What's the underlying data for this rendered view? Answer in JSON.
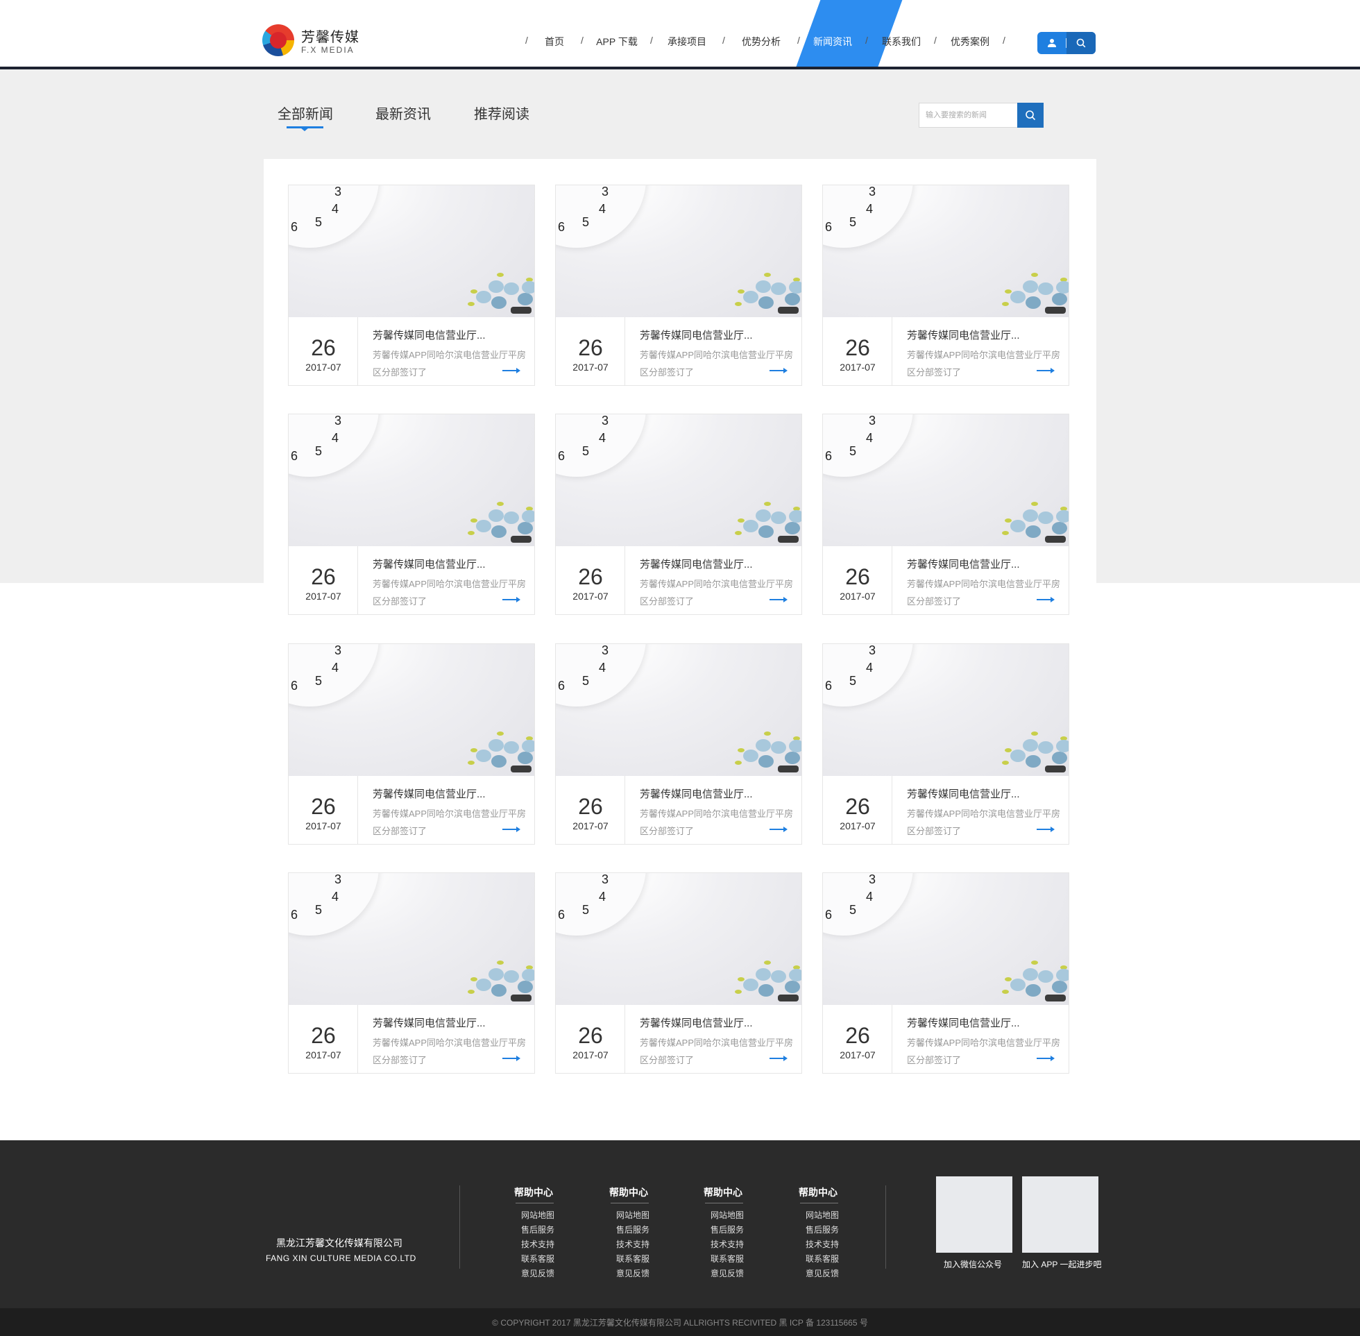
{
  "brand": {
    "name_cn": "芳馨传媒",
    "name_en": "F.X MEDIA"
  },
  "nav": {
    "items": [
      "首页",
      "APP 下载",
      "承接项目",
      "优势分析",
      "新闻资讯",
      "联系我们",
      "优秀案例"
    ],
    "active": "新闻资讯",
    "separator": "/"
  },
  "header_actions": {
    "user_icon": "user-icon",
    "search_icon": "search-icon"
  },
  "tabs": [
    "全部新闻",
    "最新资讯",
    "推荐阅读"
  ],
  "search": {
    "placeholder": "输入要搜索的新闻"
  },
  "news": {
    "items": [
      {
        "day": "26",
        "month": "2017-07",
        "title": "芳馨传媒同电信营业厅...",
        "desc": "芳馨传媒APP同哈尔滨电信营业厅平房区分部签订了"
      },
      {
        "day": "26",
        "month": "2017-07",
        "title": "芳馨传媒同电信营业厅...",
        "desc": "芳馨传媒APP同哈尔滨电信营业厅平房区分部签订了"
      },
      {
        "day": "26",
        "month": "2017-07",
        "title": "芳馨传媒同电信营业厅...",
        "desc": "芳馨传媒APP同哈尔滨电信营业厅平房区分部签订了"
      },
      {
        "day": "26",
        "month": "2017-07",
        "title": "芳馨传媒同电信营业厅...",
        "desc": "芳馨传媒APP同哈尔滨电信营业厅平房区分部签订了"
      },
      {
        "day": "26",
        "month": "2017-07",
        "title": "芳馨传媒同电信营业厅...",
        "desc": "芳馨传媒APP同哈尔滨电信营业厅平房区分部签订了"
      },
      {
        "day": "26",
        "month": "2017-07",
        "title": "芳馨传媒同电信营业厅...",
        "desc": "芳馨传媒APP同哈尔滨电信营业厅平房区分部签订了"
      },
      {
        "day": "26",
        "month": "2017-07",
        "title": "芳馨传媒同电信营业厅...",
        "desc": "芳馨传媒APP同哈尔滨电信营业厅平房区分部签订了"
      },
      {
        "day": "26",
        "month": "2017-07",
        "title": "芳馨传媒同电信营业厅...",
        "desc": "芳馨传媒APP同哈尔滨电信营业厅平房区分部签订了"
      },
      {
        "day": "26",
        "month": "2017-07",
        "title": "芳馨传媒同电信营业厅...",
        "desc": "芳馨传媒APP同哈尔滨电信营业厅平房区分部签订了"
      },
      {
        "day": "26",
        "month": "2017-07",
        "title": "芳馨传媒同电信营业厅...",
        "desc": "芳馨传媒APP同哈尔滨电信营业厅平房区分部签订了"
      },
      {
        "day": "26",
        "month": "2017-07",
        "title": "芳馨传媒同电信营业厅...",
        "desc": "芳馨传媒APP同哈尔滨电信营业厅平房区分部签订了"
      },
      {
        "day": "26",
        "month": "2017-07",
        "title": "芳馨传媒同电信营业厅...",
        "desc": "芳馨传媒APP同哈尔滨电信营业厅平房区分部签订了"
      }
    ],
    "clock_numbers": [
      "3",
      "4",
      "5",
      "6"
    ]
  },
  "footer": {
    "company_cn": "黑龙江芳馨文化传媒有限公司",
    "company_en": "FANG XIN CULTURE MEDIA CO.LTD",
    "help_columns": [
      {
        "title": "帮助中心",
        "links": [
          "网站地图",
          "售后服务",
          "技术支持",
          "联系客服",
          "意见反馈"
        ]
      },
      {
        "title": "帮助中心",
        "links": [
          "网站地图",
          "售后服务",
          "技术支持",
          "联系客服",
          "意见反馈"
        ]
      },
      {
        "title": "帮助中心",
        "links": [
          "网站地图",
          "售后服务",
          "技术支持",
          "联系客服",
          "意见反馈"
        ]
      },
      {
        "title": "帮助中心",
        "links": [
          "网站地图",
          "售后服务",
          "技术支持",
          "联系客服",
          "意见反馈"
        ]
      }
    ],
    "qr_codes": [
      "加入微信公众号",
      "加入 APP 一起进步吧"
    ],
    "copyright": "© COPYRIGHT 2017 黑龙江芳馨文化传媒有限公司 ALLRIGHTS RECIVITED 黑 ICP 备 123115665 号"
  },
  "colors": {
    "accent": "#1f7fe0",
    "nav_active": "#2d8df0",
    "footer_bg": "#2b2b2b",
    "band_bg": "#efefef"
  }
}
